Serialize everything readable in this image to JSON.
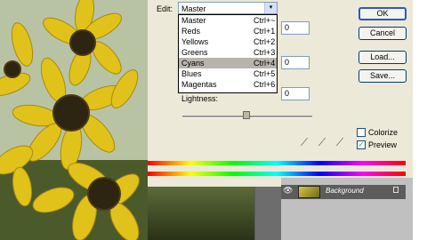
{
  "dialog": {
    "edit_label": "Edit:",
    "edit_value": "Master",
    "menu_items": [
      {
        "label": "Master",
        "shortcut": "Ctrl+~"
      },
      {
        "label": "Reds",
        "shortcut": "Ctrl+1"
      },
      {
        "label": "Yellows",
        "shortcut": "Ctrl+2"
      },
      {
        "label": "Greens",
        "shortcut": "Ctrl+3"
      },
      {
        "label": "Cyans",
        "shortcut": "Ctrl+4"
      },
      {
        "label": "Blues",
        "shortcut": "Ctrl+5"
      },
      {
        "label": "Magentas",
        "shortcut": "Ctrl+6"
      }
    ],
    "field_values": [
      "0",
      "0",
      "0"
    ],
    "lightness_label": "Lightness:",
    "lightness_value": 0,
    "buttons": {
      "ok": "OK",
      "cancel": "Cancel",
      "load": "Load...",
      "save": "Save..."
    },
    "colorize_label": "Colorize",
    "colorize_checked": false,
    "preview_label": "Preview",
    "preview_checked": true,
    "preview_check_glyph": "✓"
  },
  "layers": {
    "background_label": "Background",
    "eye_glyph": "👁"
  },
  "icons": {
    "dropdown_arrow": "▾",
    "eyedropper": "⟋"
  }
}
